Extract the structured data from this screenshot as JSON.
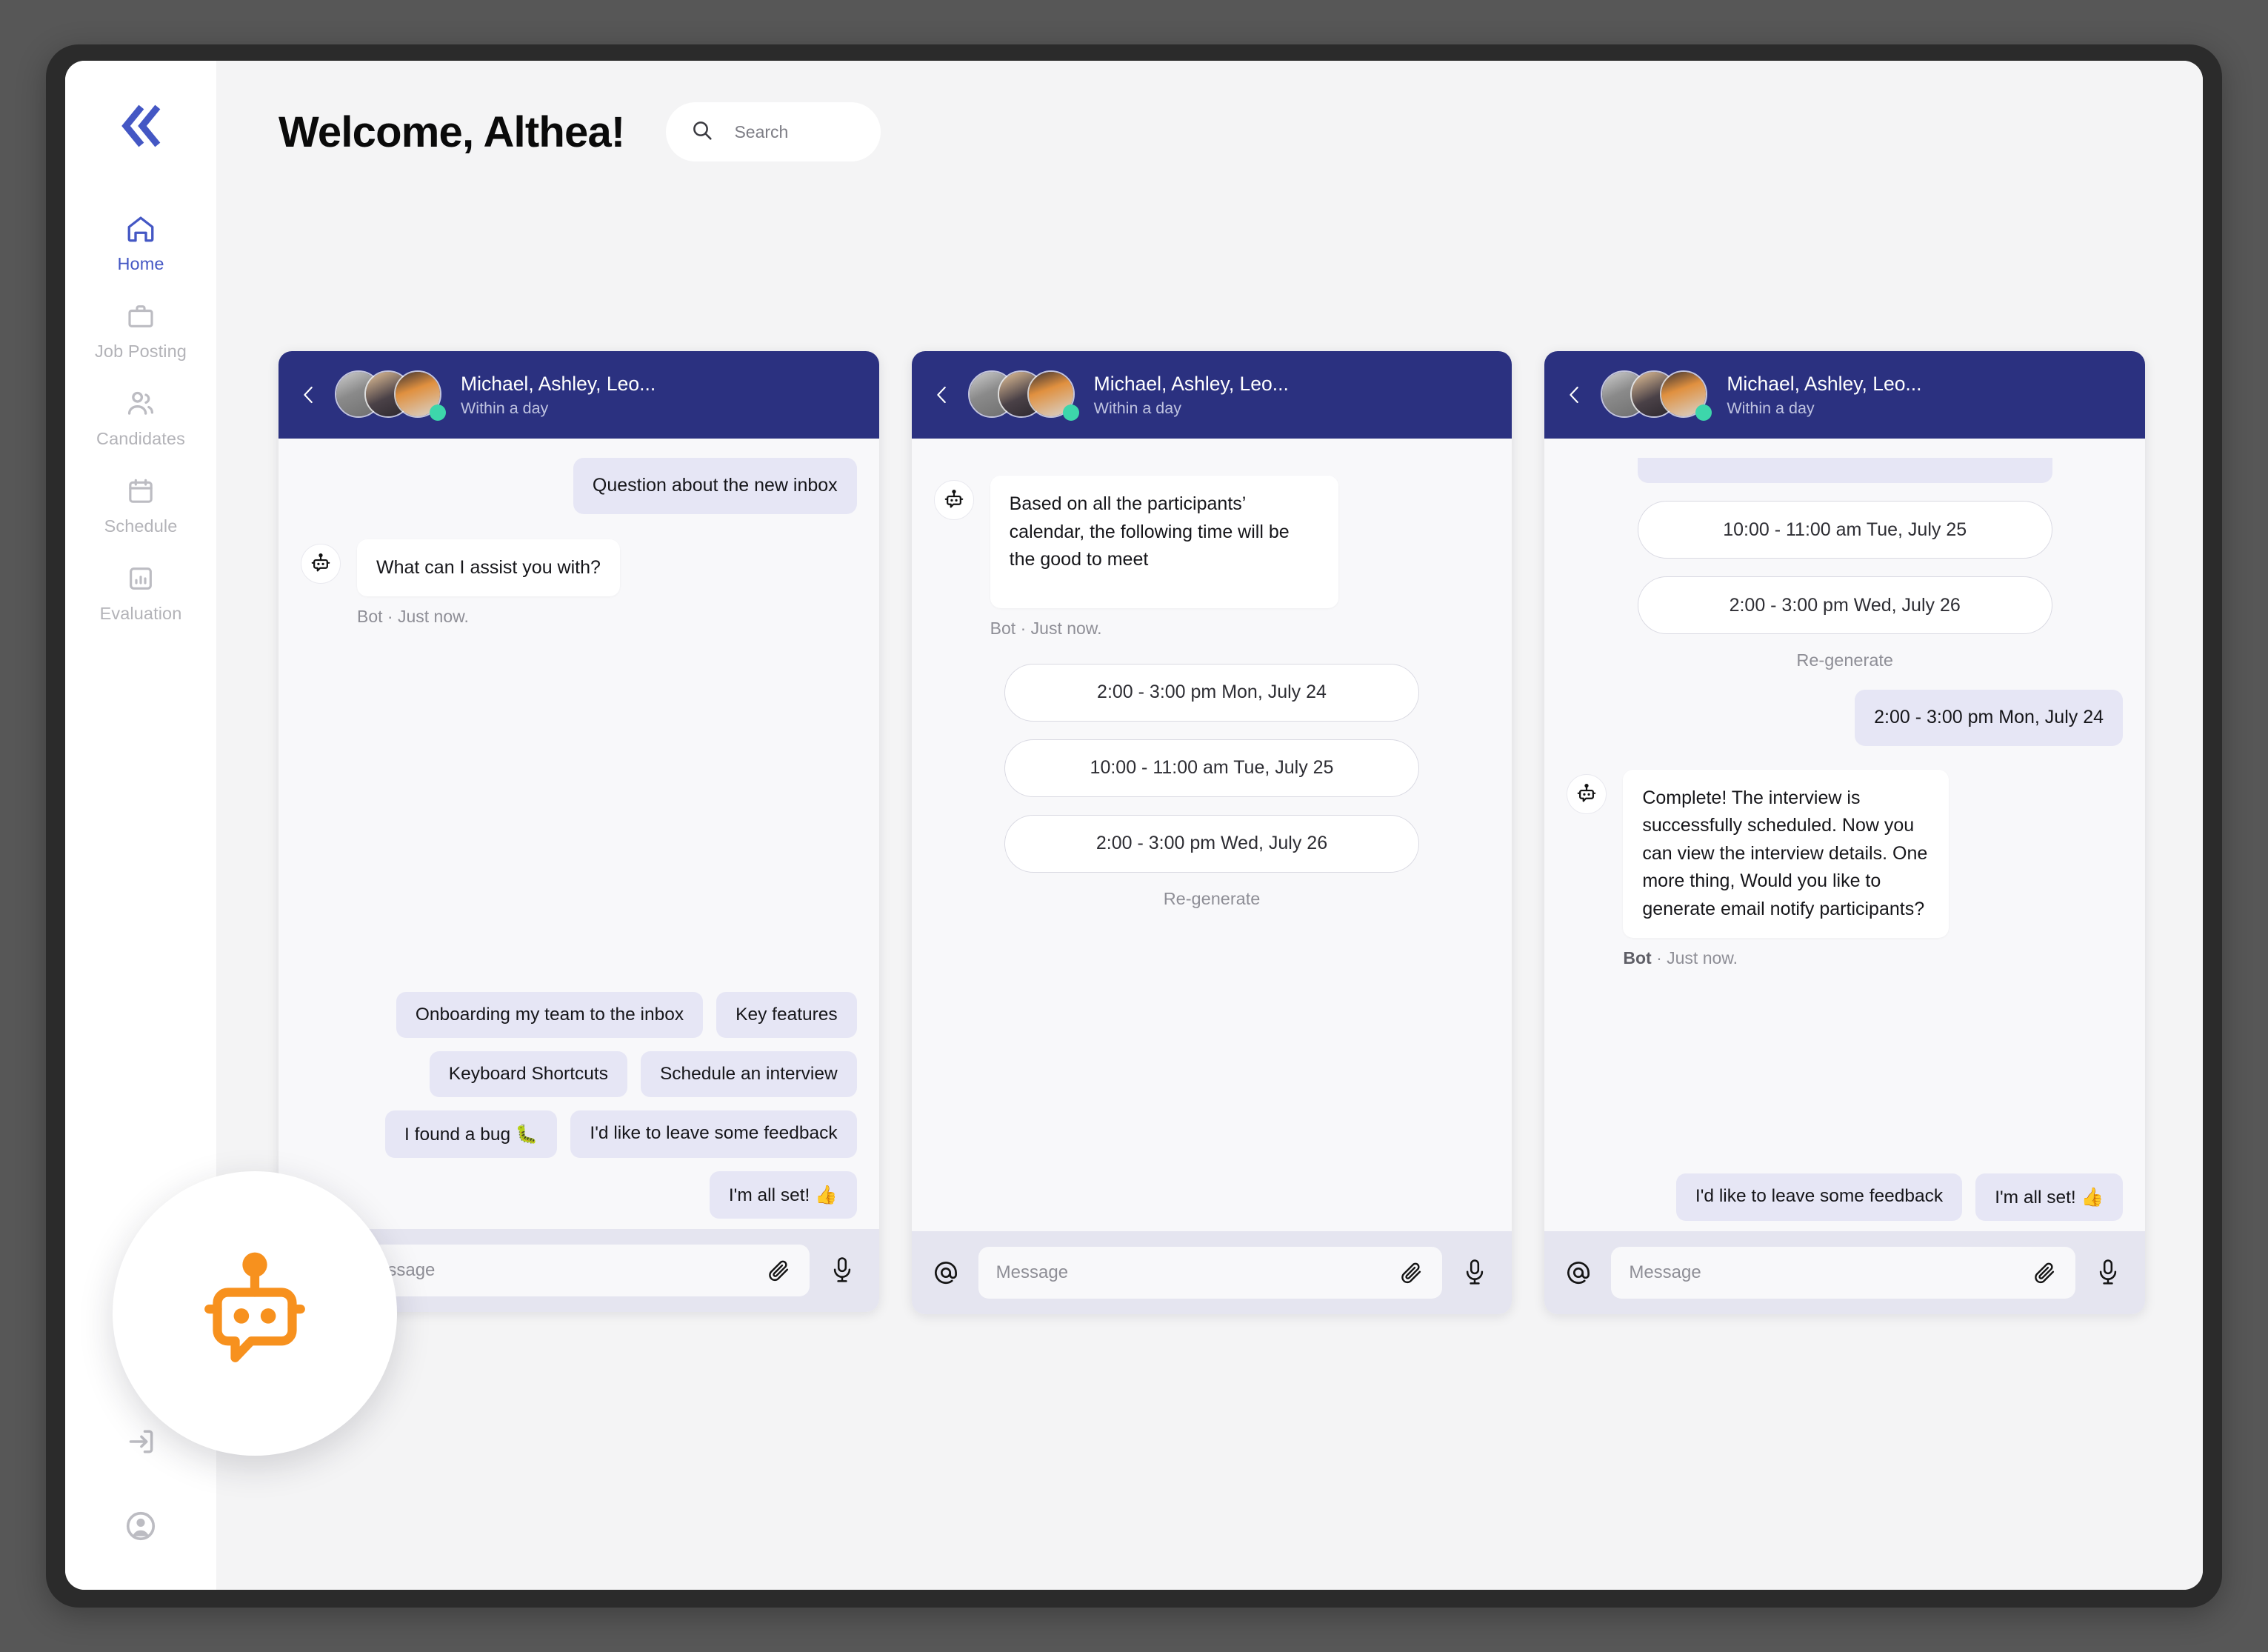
{
  "app": {
    "logo_name": "double-chevron-left-logo"
  },
  "sidebar": {
    "items": [
      {
        "label": "Home",
        "icon": "home-icon",
        "active": true
      },
      {
        "label": "Job Posting",
        "icon": "briefcase-icon",
        "active": false
      },
      {
        "label": "Candidates",
        "icon": "people-icon",
        "active": false
      },
      {
        "label": "Schedule",
        "icon": "calendar-icon",
        "active": false
      },
      {
        "label": "Evaluation",
        "icon": "bar-chart-icon",
        "active": false
      }
    ],
    "bottom_icons": [
      {
        "icon": "logout-icon"
      },
      {
        "icon": "account-circle-icon"
      }
    ]
  },
  "header": {
    "title": "Welcome, Althea!",
    "search_placeholder": "Search",
    "search_icon": "search-icon"
  },
  "conversation_header": {
    "name": "Michael, Ashley, Leo...",
    "status": "Within a day",
    "back_icon": "chevron-left-icon"
  },
  "composer": {
    "placeholder": "Message",
    "at_icon": "at-mention-icon",
    "clip_icon": "paperclip-icon",
    "mic_icon": "microphone-icon"
  },
  "fab": {
    "icon": "robot-bot-icon",
    "color": "#f7911e"
  },
  "panel1": {
    "user_message": "Question about the new inbox",
    "bot_message": "What can I assist you with?",
    "meta_author": "Bot",
    "meta_time": "Just now.",
    "chips": [
      "Onboarding my team to the inbox",
      "Key features",
      "Keyboard Shortcuts",
      "Schedule an interview",
      "I found a bug 🐛",
      "I'd like to leave some feedback",
      "I'm all set! 👍"
    ]
  },
  "panel2": {
    "bot_message": "Based on all the participants’ calendar, the following time will be the good to meet",
    "meta_author": "Bot",
    "meta_time": "Just now.",
    "slots": [
      "2:00 - 3:00 pm Mon, July 24",
      "10:00 - 11:00 am Tue, July 25",
      "2:00 - 3:00 pm Wed, July 26"
    ],
    "regenerate_label": "Re-generate"
  },
  "panel3": {
    "slots": [
      "10:00 - 11:00 am Tue, July 25",
      "2:00 - 3:00 pm Wed, July 26"
    ],
    "regenerate_label": "Re-generate",
    "user_selection": "2:00 - 3:00 pm Mon, July 24",
    "bot_message": "Complete! The interview is successfully scheduled. Now you can view the interview details. One more thing, Would you like to generate email notify participants?",
    "meta_author": "Bot",
    "meta_time": "Just now.",
    "chips": [
      "I'd like to leave some feedback",
      "I'm all set! 👍"
    ]
  },
  "colors": {
    "brand_blue": "#4457c4",
    "header_navy": "#2b3180",
    "accent_orange": "#f7911e",
    "online_green": "#3dd6ab",
    "chip_lavender": "#e6e6f5"
  }
}
